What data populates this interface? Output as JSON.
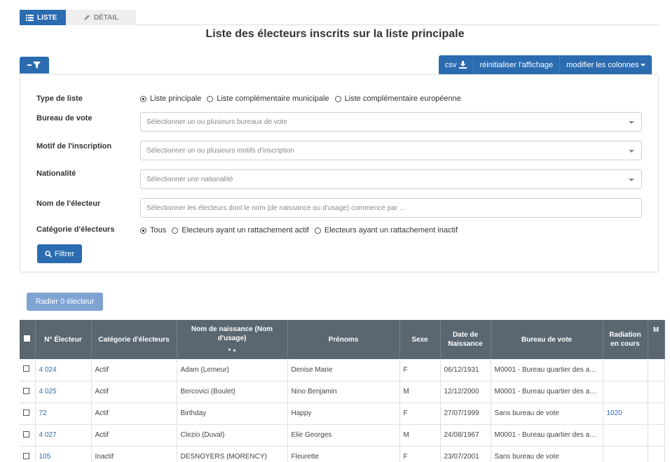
{
  "tabs": [
    {
      "label": "LISTE",
      "icon": "list-icon",
      "active": true
    },
    {
      "label": "DÉTAIL",
      "icon": "pencil-icon",
      "active": false
    }
  ],
  "page_title": "Liste des électeurs inscrits sur la liste principale",
  "toolbar": {
    "csv_label": "csv",
    "reset_label": "réinitialiser l'affichage",
    "columns_label": "modifier les colonnes"
  },
  "filters": {
    "type_liste": {
      "label": "Type de liste",
      "options": [
        "Liste principale",
        "Liste complémentaire municipale",
        "Liste complémentaire européenne"
      ],
      "selected": 0
    },
    "bureau": {
      "label": "Bureau de vote",
      "placeholder": "Sélectionner un ou plusieurs bureaux de vote"
    },
    "motif": {
      "label": "Motif de l'inscription",
      "placeholder": "Sélectionner un ou plusieurs motifs d'inscription"
    },
    "nationalite": {
      "label": "Nationalité",
      "placeholder": "Sélectionner une nationalité"
    },
    "nom": {
      "label": "Nom de l'électeur",
      "placeholder": "Sélectionner les électeurs dont le nom (de naissance ou d'usage) commence par ..."
    },
    "categorie": {
      "label": "Catégorie d'électeurs",
      "options": [
        "Tous",
        "Electeurs ayant un rattachement actif",
        "Electeurs ayant un rattachement inactif"
      ],
      "selected": 0
    },
    "filter_button": "Filtrer"
  },
  "radier_button": "Radier 0 électeur",
  "table": {
    "headers": [
      "N° Électeur",
      "Catégorie d'électeurs",
      "Nom de naissance (Nom d'usage)",
      "Prénoms",
      "Sexe",
      "Date de Naissance",
      "Bureau de vote",
      "Radiation en cours",
      "M"
    ],
    "rows": [
      {
        "numero": "4 024",
        "categorie": "Actif",
        "nom": "Adam (Lemeur)",
        "prenoms": "Denise Marie",
        "sexe": "F",
        "naissance": "06/12/1931",
        "bureau": "M0001 - Bureau quartier des anc...",
        "radiation": ""
      },
      {
        "numero": "4 025",
        "categorie": "Actif",
        "nom": "Bercovici (Boulet)",
        "prenoms": "Nino Benjamin",
        "sexe": "M",
        "naissance": "12/12/2000",
        "bureau": "M0001 - Bureau quartier des anc...",
        "radiation": ""
      },
      {
        "numero": "72",
        "categorie": "Actif",
        "nom": "Birthday",
        "prenoms": "Happy",
        "sexe": "F",
        "naissance": "27/07/1999",
        "bureau": "Sans bureau de vote",
        "radiation": "1020"
      },
      {
        "numero": "4 027",
        "categorie": "Actif",
        "nom": "Clezio (Duval)",
        "prenoms": "Elie Georges",
        "sexe": "M",
        "naissance": "24/08/1967",
        "bureau": "M0001 - Bureau quartier des anc...",
        "radiation": ""
      },
      {
        "numero": "105",
        "categorie": "Inactif",
        "nom": "DESNOYERS (MORENCY)",
        "prenoms": "Fleurette",
        "sexe": "F",
        "naissance": "23/07/2001",
        "bureau": "Sans bureau de vote",
        "radiation": ""
      }
    ]
  },
  "colors": {
    "primary": "#2b6cb0",
    "table_header": "#5a6670",
    "disabled": "#7fa3d3"
  }
}
